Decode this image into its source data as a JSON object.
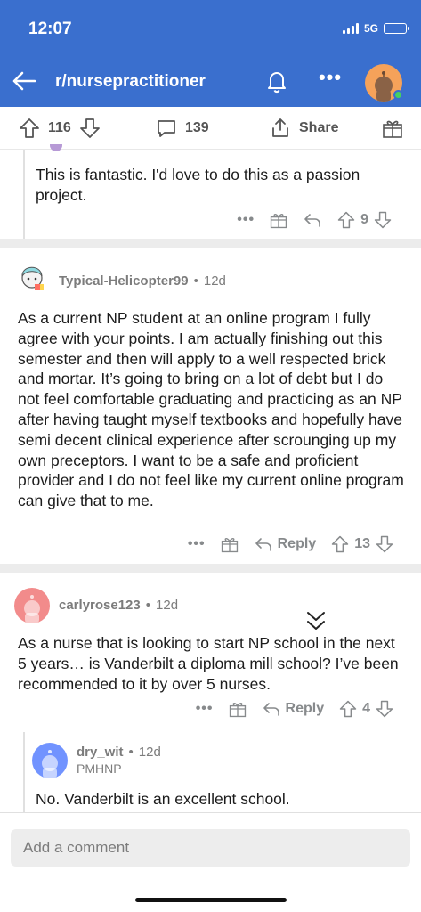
{
  "status": {
    "time": "12:07",
    "network": "5G"
  },
  "nav": {
    "title": "r/nursepractitioner",
    "more": "•••"
  },
  "post_actions": {
    "upvotes": "116",
    "comments": "139",
    "share": "Share"
  },
  "comments": [
    {
      "text": "This is fantastic. I'd love to do this as a passion project.",
      "score": "9"
    },
    {
      "user": "Typical-Helicopter99",
      "age": "12d",
      "text": "As a current NP student at an online program I fully agree with your points. I am actually finishing out this semester and then will apply to a well respected brick and mortar. It’s going to bring on a lot of debt but I do not feel comfortable graduating and practicing as an NP after having taught myself textbooks and hopefully have semi decent clinical experience after scrounging up my own preceptors. I want to be a safe and proficient provider and I do not feel like my current online program can give that to me.",
      "reply": "Reply",
      "score": "13"
    },
    {
      "user": "carlyrose123",
      "age": "12d",
      "text": "As a nurse that is looking to start NP school in the next 5 years… is Vanderbilt a diploma mill school? I’ve been recommended to it by over 5 nurses.",
      "reply": "Reply",
      "score": "4"
    },
    {
      "user": "dry_wit",
      "age": "12d",
      "flair": "PMHNP",
      "text": "No. Vanderbilt is an excellent school."
    }
  ],
  "composer": {
    "placeholder": "Add a comment"
  },
  "colors": {
    "brand": "#3a6fce",
    "muted": "#878a8c"
  },
  "icons": [
    "back-arrow-icon",
    "bell-icon",
    "more-icon",
    "upvote-icon",
    "downvote-icon",
    "comment-icon",
    "share-icon",
    "award-icon",
    "reply-icon",
    "collapse-icon"
  ]
}
